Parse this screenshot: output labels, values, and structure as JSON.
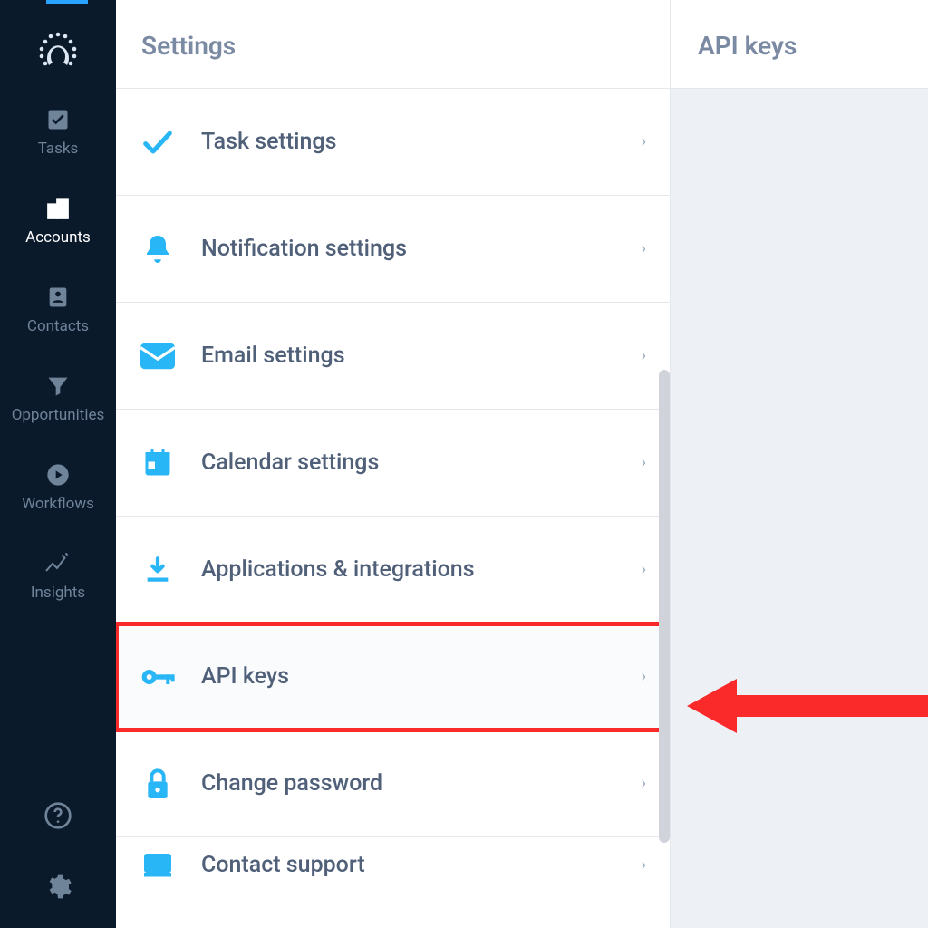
{
  "colors": {
    "accent": "#29b6f6",
    "sidebar_bg": "#0b1a2b",
    "annotation": "#fa2a2a"
  },
  "sidebar": {
    "items": [
      {
        "id": "tasks",
        "label": "Tasks",
        "icon": "check-square-icon"
      },
      {
        "id": "accounts",
        "label": "Accounts",
        "icon": "buildings-icon",
        "active": true
      },
      {
        "id": "contacts",
        "label": "Contacts",
        "icon": "contact-card-icon"
      },
      {
        "id": "opportunities",
        "label": "Opportunities",
        "icon": "funnel-icon"
      },
      {
        "id": "workflows",
        "label": "Workflows",
        "icon": "play-circle-icon"
      },
      {
        "id": "insights",
        "label": "Insights",
        "icon": "sparkle-trend-icon"
      }
    ],
    "bottom": [
      {
        "id": "help",
        "icon": "help-circle-icon"
      },
      {
        "id": "settings",
        "icon": "gear-icon"
      }
    ]
  },
  "settings": {
    "title": "Settings",
    "rows": [
      {
        "id": "task",
        "label": "Task settings",
        "icon": "check-icon"
      },
      {
        "id": "notif",
        "label": "Notification settings",
        "icon": "bell-icon"
      },
      {
        "id": "email",
        "label": "Email settings",
        "icon": "mail-icon"
      },
      {
        "id": "cal",
        "label": "Calendar settings",
        "icon": "calendar-icon"
      },
      {
        "id": "apps",
        "label": "Applications & integrations",
        "icon": "download-icon"
      },
      {
        "id": "api",
        "label": "API keys",
        "icon": "key-icon",
        "highlighted": true
      },
      {
        "id": "pwd",
        "label": "Change password",
        "icon": "lock-icon"
      },
      {
        "id": "sup",
        "label": "Contact support",
        "icon": "support-icon"
      }
    ]
  },
  "detail": {
    "title": "API keys"
  }
}
